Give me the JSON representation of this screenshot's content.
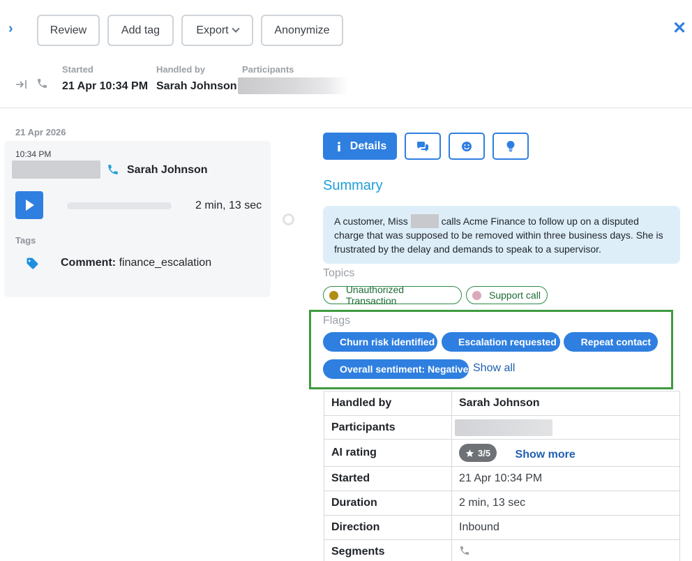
{
  "toolbar": {
    "review_label": "Review",
    "add_tag_label": "Add tag",
    "export_label": "Export",
    "anonymize_label": "Anonymize"
  },
  "call_header": {
    "started_label": "Started",
    "started_value": "21 Apr 10:34 PM",
    "handled_by_label": "Handled by",
    "handled_by_value": "Sarah Johnson",
    "participants_label": "Participants"
  },
  "timeline": {
    "date": "21 Apr 2026",
    "call": {
      "time": "10:34 PM",
      "agent_name": "Sarah Johnson",
      "duration": "2 min, 13 sec",
      "playback_progress": 0.0
    },
    "tags_label": "Tags",
    "comment_label": "Comment:",
    "comment_value": "finance_escalation"
  },
  "detail_tabs": {
    "details_label": "Details",
    "icons": [
      "chat-bubbles-icon",
      "smiley-icon",
      "lightbulb-icon"
    ]
  },
  "summary": {
    "title": "Summary",
    "text_before_name": "A customer, Miss ",
    "text_after_name": " calls Acme Finance to follow up on a disputed charge that was supposed to be removed within three business days. She is frustrated by the delay and demands to speak to a supervisor."
  },
  "topics": {
    "label": "Topics",
    "items": [
      {
        "label": "Unauthorized Transaction",
        "dot_color": "#b08d15"
      },
      {
        "label": "Support call",
        "dot_color": "#dba9b9"
      }
    ]
  },
  "flags": {
    "label": "Flags",
    "items": [
      "Churn risk identified",
      "Escalation requested",
      "Repeat contact",
      "Overall sentiment: Negative"
    ],
    "show_all_label": "Show all"
  },
  "details_table": {
    "rows": [
      {
        "key": "Handled by",
        "value": "Sarah Johnson"
      },
      {
        "key": "Participants",
        "value": ""
      },
      {
        "key": "AI rating",
        "value": "3/5",
        "action": "Show more"
      },
      {
        "key": "Started",
        "value": "21 Apr 10:34 PM"
      },
      {
        "key": "Duration",
        "value": "2 min, 13 sec"
      },
      {
        "key": "Direction",
        "value": "Inbound"
      },
      {
        "key": "Segments",
        "value": ""
      }
    ]
  },
  "colors": {
    "accent": "#2f7fe0",
    "summary_title": "#1e9fd8",
    "summary_bg": "#ddeef9",
    "highlight_border": "#3f9a3f"
  }
}
